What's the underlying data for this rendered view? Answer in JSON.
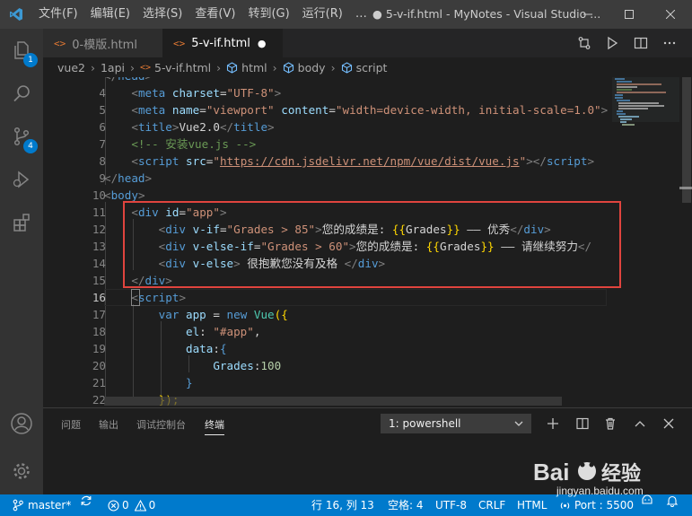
{
  "titlebar": {
    "menu": [
      "文件(F)",
      "编辑(E)",
      "选择(S)",
      "查看(V)",
      "转到(G)",
      "运行(R)"
    ],
    "more_menu": "…",
    "title": "● 5-v-if.html - MyNotes - Visual Studio ..."
  },
  "activity": {
    "explorer_badge": "1",
    "scm_badge": "4"
  },
  "tabs": [
    {
      "icon": "<>",
      "label": "0-模版.html"
    },
    {
      "icon": "<>",
      "label": "5-v-if.html",
      "dirty": "●"
    }
  ],
  "breadcrumb": [
    "vue2",
    "1api",
    "5-v-if.html",
    "html",
    "body",
    "script"
  ],
  "editor": {
    "line_numbers": [
      "4",
      "5",
      "6",
      "7",
      "8",
      "9",
      "10",
      "11",
      "12",
      "13",
      "14",
      "15",
      "16",
      "17",
      "18",
      "19",
      "20",
      "21",
      "22"
    ]
  },
  "panel": {
    "tabs": [
      "问题",
      "输出",
      "调试控制台",
      "终端"
    ],
    "terminal_select": "1: powershell"
  },
  "status": {
    "branch": "master*",
    "errors": "0",
    "warnings": "0",
    "cursor": "行 16, 列 13",
    "indent": "空格: 4",
    "encoding": "UTF-8",
    "eol": "CRLF",
    "language": "HTML",
    "port": "Port : 5500"
  },
  "watermark": {
    "brand": "Bai 经验",
    "url": "jingyan.baidu.com"
  },
  "colors": {
    "accent": "#007acc",
    "highlight_box": "#e0443e"
  }
}
